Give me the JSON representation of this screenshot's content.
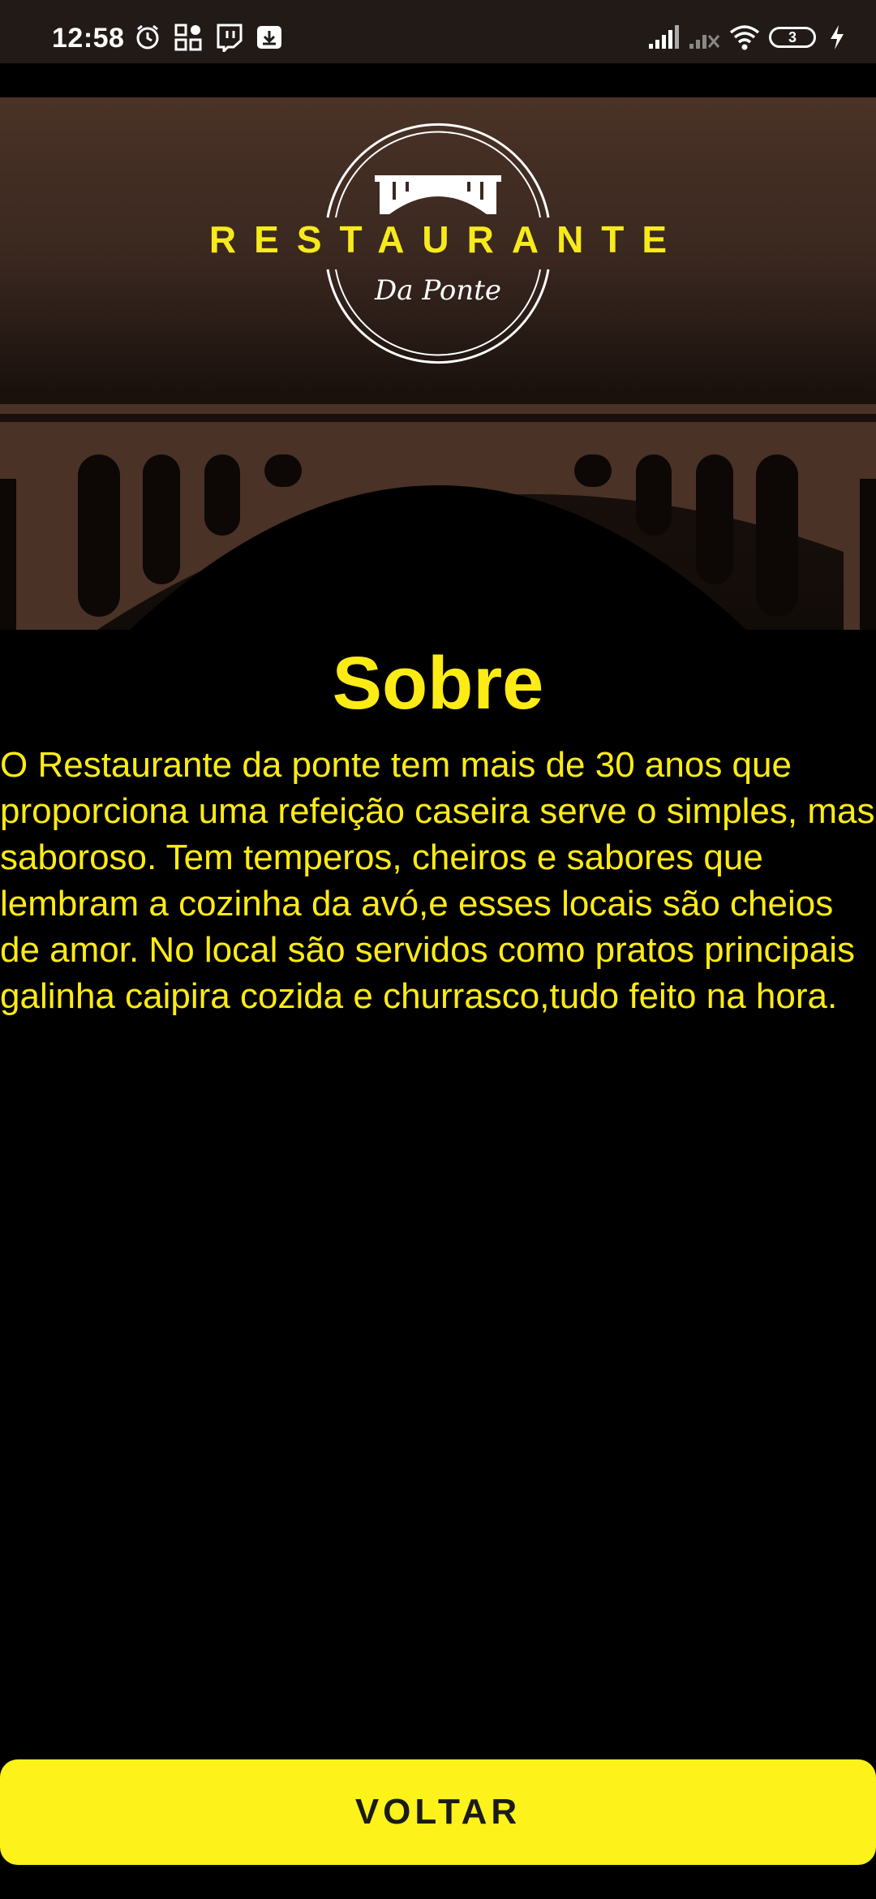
{
  "status_bar": {
    "time": "12:58",
    "left_icons": [
      "alarm-icon",
      "apps-grid-icon",
      "twitch-icon",
      "download-icon"
    ],
    "right_icons": [
      "signal-icon",
      "signal-no-sim-icon",
      "wifi-icon",
      "battery-icon",
      "charging-icon"
    ],
    "battery_level": "3"
  },
  "header": {
    "brand_name": "RESTAURANTE",
    "brand_subtitle": "Da Ponte",
    "accent_color": "#f7ea1c",
    "background_color": "#3a2820"
  },
  "content": {
    "title": "Sobre",
    "body": "O Restaurante da ponte tem mais de 30 anos que proporciona uma refeição caseira serve o simples, mas saboroso. Tem temperos, cheiros e sabores que lembram a cozinha da avó,e esses locais são cheios de amor. No local são servidos como pratos principais galinha caipira cozida e churrasco,tudo feito na hora.",
    "text_color": "#fdeb15"
  },
  "actions": {
    "back_label": "VOLTAR",
    "button_color": "#fdf219"
  }
}
